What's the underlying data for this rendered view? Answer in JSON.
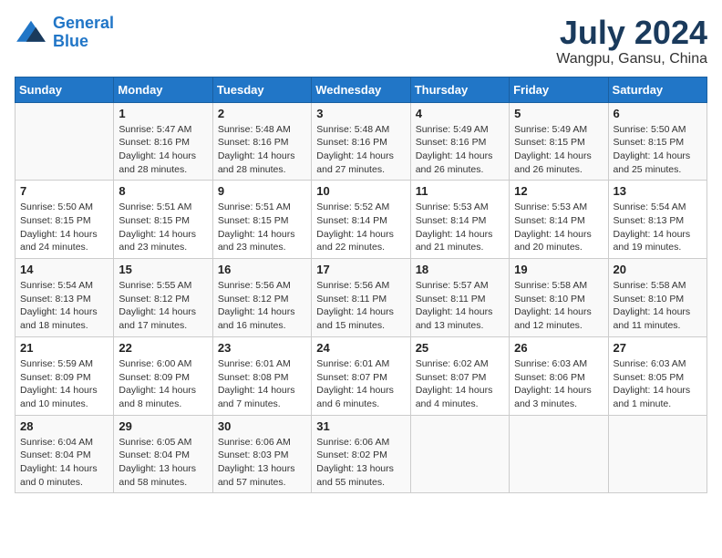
{
  "header": {
    "logo_line1": "General",
    "logo_line2": "Blue",
    "main_title": "July 2024",
    "subtitle": "Wangpu, Gansu, China"
  },
  "weekdays": [
    "Sunday",
    "Monday",
    "Tuesday",
    "Wednesday",
    "Thursday",
    "Friday",
    "Saturday"
  ],
  "weeks": [
    [
      {
        "day": "",
        "info": ""
      },
      {
        "day": "1",
        "info": "Sunrise: 5:47 AM\nSunset: 8:16 PM\nDaylight: 14 hours\nand 28 minutes."
      },
      {
        "day": "2",
        "info": "Sunrise: 5:48 AM\nSunset: 8:16 PM\nDaylight: 14 hours\nand 28 minutes."
      },
      {
        "day": "3",
        "info": "Sunrise: 5:48 AM\nSunset: 8:16 PM\nDaylight: 14 hours\nand 27 minutes."
      },
      {
        "day": "4",
        "info": "Sunrise: 5:49 AM\nSunset: 8:16 PM\nDaylight: 14 hours\nand 26 minutes."
      },
      {
        "day": "5",
        "info": "Sunrise: 5:49 AM\nSunset: 8:15 PM\nDaylight: 14 hours\nand 26 minutes."
      },
      {
        "day": "6",
        "info": "Sunrise: 5:50 AM\nSunset: 8:15 PM\nDaylight: 14 hours\nand 25 minutes."
      }
    ],
    [
      {
        "day": "7",
        "info": "Sunrise: 5:50 AM\nSunset: 8:15 PM\nDaylight: 14 hours\nand 24 minutes."
      },
      {
        "day": "8",
        "info": "Sunrise: 5:51 AM\nSunset: 8:15 PM\nDaylight: 14 hours\nand 23 minutes."
      },
      {
        "day": "9",
        "info": "Sunrise: 5:51 AM\nSunset: 8:15 PM\nDaylight: 14 hours\nand 23 minutes."
      },
      {
        "day": "10",
        "info": "Sunrise: 5:52 AM\nSunset: 8:14 PM\nDaylight: 14 hours\nand 22 minutes."
      },
      {
        "day": "11",
        "info": "Sunrise: 5:53 AM\nSunset: 8:14 PM\nDaylight: 14 hours\nand 21 minutes."
      },
      {
        "day": "12",
        "info": "Sunrise: 5:53 AM\nSunset: 8:14 PM\nDaylight: 14 hours\nand 20 minutes."
      },
      {
        "day": "13",
        "info": "Sunrise: 5:54 AM\nSunset: 8:13 PM\nDaylight: 14 hours\nand 19 minutes."
      }
    ],
    [
      {
        "day": "14",
        "info": "Sunrise: 5:54 AM\nSunset: 8:13 PM\nDaylight: 14 hours\nand 18 minutes."
      },
      {
        "day": "15",
        "info": "Sunrise: 5:55 AM\nSunset: 8:12 PM\nDaylight: 14 hours\nand 17 minutes."
      },
      {
        "day": "16",
        "info": "Sunrise: 5:56 AM\nSunset: 8:12 PM\nDaylight: 14 hours\nand 16 minutes."
      },
      {
        "day": "17",
        "info": "Sunrise: 5:56 AM\nSunset: 8:11 PM\nDaylight: 14 hours\nand 15 minutes."
      },
      {
        "day": "18",
        "info": "Sunrise: 5:57 AM\nSunset: 8:11 PM\nDaylight: 14 hours\nand 13 minutes."
      },
      {
        "day": "19",
        "info": "Sunrise: 5:58 AM\nSunset: 8:10 PM\nDaylight: 14 hours\nand 12 minutes."
      },
      {
        "day": "20",
        "info": "Sunrise: 5:58 AM\nSunset: 8:10 PM\nDaylight: 14 hours\nand 11 minutes."
      }
    ],
    [
      {
        "day": "21",
        "info": "Sunrise: 5:59 AM\nSunset: 8:09 PM\nDaylight: 14 hours\nand 10 minutes."
      },
      {
        "day": "22",
        "info": "Sunrise: 6:00 AM\nSunset: 8:09 PM\nDaylight: 14 hours\nand 8 minutes."
      },
      {
        "day": "23",
        "info": "Sunrise: 6:01 AM\nSunset: 8:08 PM\nDaylight: 14 hours\nand 7 minutes."
      },
      {
        "day": "24",
        "info": "Sunrise: 6:01 AM\nSunset: 8:07 PM\nDaylight: 14 hours\nand 6 minutes."
      },
      {
        "day": "25",
        "info": "Sunrise: 6:02 AM\nSunset: 8:07 PM\nDaylight: 14 hours\nand 4 minutes."
      },
      {
        "day": "26",
        "info": "Sunrise: 6:03 AM\nSunset: 8:06 PM\nDaylight: 14 hours\nand 3 minutes."
      },
      {
        "day": "27",
        "info": "Sunrise: 6:03 AM\nSunset: 8:05 PM\nDaylight: 14 hours\nand 1 minute."
      }
    ],
    [
      {
        "day": "28",
        "info": "Sunrise: 6:04 AM\nSunset: 8:04 PM\nDaylight: 14 hours\nand 0 minutes."
      },
      {
        "day": "29",
        "info": "Sunrise: 6:05 AM\nSunset: 8:04 PM\nDaylight: 13 hours\nand 58 minutes."
      },
      {
        "day": "30",
        "info": "Sunrise: 6:06 AM\nSunset: 8:03 PM\nDaylight: 13 hours\nand 57 minutes."
      },
      {
        "day": "31",
        "info": "Sunrise: 6:06 AM\nSunset: 8:02 PM\nDaylight: 13 hours\nand 55 minutes."
      },
      {
        "day": "",
        "info": ""
      },
      {
        "day": "",
        "info": ""
      },
      {
        "day": "",
        "info": ""
      }
    ]
  ]
}
